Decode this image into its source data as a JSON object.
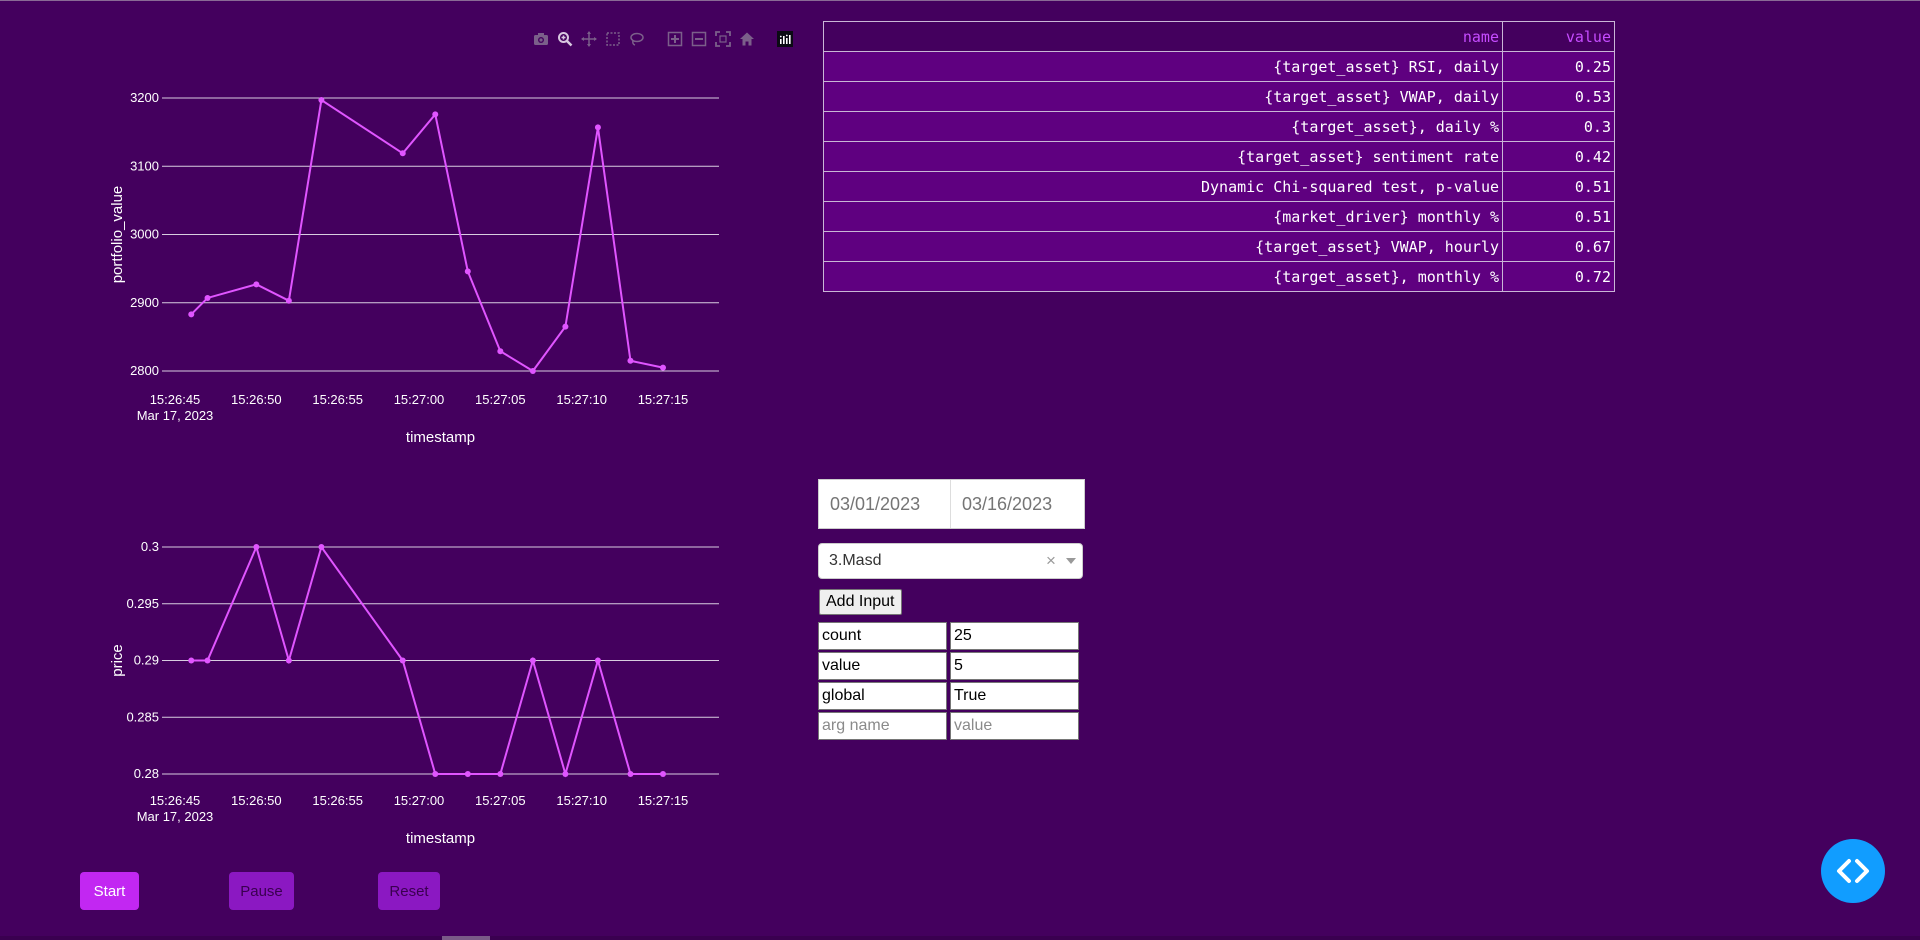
{
  "chart_data": [
    {
      "type": "line",
      "title": "",
      "xlabel": "timestamp",
      "ylabel": "portfolio_value",
      "x": [
        "15:26:46",
        "15:26:47",
        "15:26:50",
        "15:26:52",
        "15:26:54",
        "15:26:59",
        "15:27:01",
        "15:27:03",
        "15:27:05",
        "15:27:07",
        "15:27:09",
        "15:27:11",
        "15:27:13",
        "15:27:15"
      ],
      "x_ticks": [
        "15:26:45",
        "15:26:50",
        "15:26:55",
        "15:27:00",
        "15:27:05",
        "15:27:10",
        "15:27:15"
      ],
      "x_tick_sub": "Mar 17, 2023",
      "series": [
        {
          "values": [
            2883,
            2907,
            2927,
            2903,
            3197,
            3119,
            3176,
            2946,
            2829,
            2800,
            2865,
            3157,
            2815,
            2805
          ]
        }
      ],
      "y_ticks": [
        2800,
        2900,
        3000,
        3100,
        3200
      ],
      "ylim": [
        2800,
        3200
      ],
      "grid": true,
      "color": "#e055ff"
    },
    {
      "type": "line",
      "title": "",
      "xlabel": "timestamp",
      "ylabel": "price",
      "x": [
        "15:26:46",
        "15:26:47",
        "15:26:50",
        "15:26:52",
        "15:26:54",
        "15:26:59",
        "15:27:01",
        "15:27:03",
        "15:27:05",
        "15:27:07",
        "15:27:09",
        "15:27:11",
        "15:27:13",
        "15:27:15"
      ],
      "x_ticks": [
        "15:26:45",
        "15:26:50",
        "15:26:55",
        "15:27:00",
        "15:27:05",
        "15:27:10",
        "15:27:15"
      ],
      "x_tick_sub": "Mar 17, 2023",
      "series": [
        {
          "values": [
            0.29,
            0.29,
            0.3,
            0.29,
            0.3,
            0.29,
            0.28,
            0.28,
            0.28,
            0.29,
            0.28,
            0.29,
            0.28,
            0.28
          ]
        }
      ],
      "y_ticks": [
        0.28,
        0.285,
        0.29,
        0.295,
        0.3
      ],
      "ylim": [
        0.28,
        0.3
      ],
      "grid": true,
      "color": "#e055ff"
    }
  ],
  "modebar": {
    "icons": [
      "camera-icon",
      "zoom-icon",
      "pan-icon",
      "box-select-icon",
      "lasso-icon",
      "zoom-in-icon",
      "zoom-out-icon",
      "autoscale-icon",
      "reset-axes-icon",
      "plotly-logo-icon"
    ]
  },
  "table": {
    "headers": {
      "name": "name",
      "value": "value"
    },
    "rows": [
      {
        "name": "{target_asset} RSI, daily",
        "value": "0.25"
      },
      {
        "name": "{target_asset} VWAP, daily",
        "value": "0.53"
      },
      {
        "name": "{target_asset}, daily %",
        "value": "0.3"
      },
      {
        "name": "{target_asset} sentiment rate",
        "value": "0.42"
      },
      {
        "name": "Dynamic Chi-squared test, p-value",
        "value": "0.51"
      },
      {
        "name": "{market_driver} monthly %",
        "value": "0.51"
      },
      {
        "name": "{target_asset} VWAP, hourly",
        "value": "0.67"
      },
      {
        "name": "{target_asset}, monthly %",
        "value": "0.72"
      }
    ]
  },
  "date_range": {
    "start": "03/01/2023",
    "end": "03/16/2023"
  },
  "dropdown": {
    "selected": "3.Masd",
    "clear_symbol": "×"
  },
  "add_input": {
    "label": "Add Input"
  },
  "args": [
    {
      "name": "count",
      "value": "25"
    },
    {
      "name": "value",
      "value": "5"
    },
    {
      "name": "global",
      "value": "True"
    }
  ],
  "new_arg": {
    "name_placeholder": "arg name",
    "value_placeholder": "value"
  },
  "controls": {
    "start": "Start",
    "pause": "Pause",
    "reset": "Reset"
  },
  "colors": {
    "background": "#44005e",
    "line": "#e055ff",
    "accent": "#c227f2",
    "fab": "#119dff"
  }
}
